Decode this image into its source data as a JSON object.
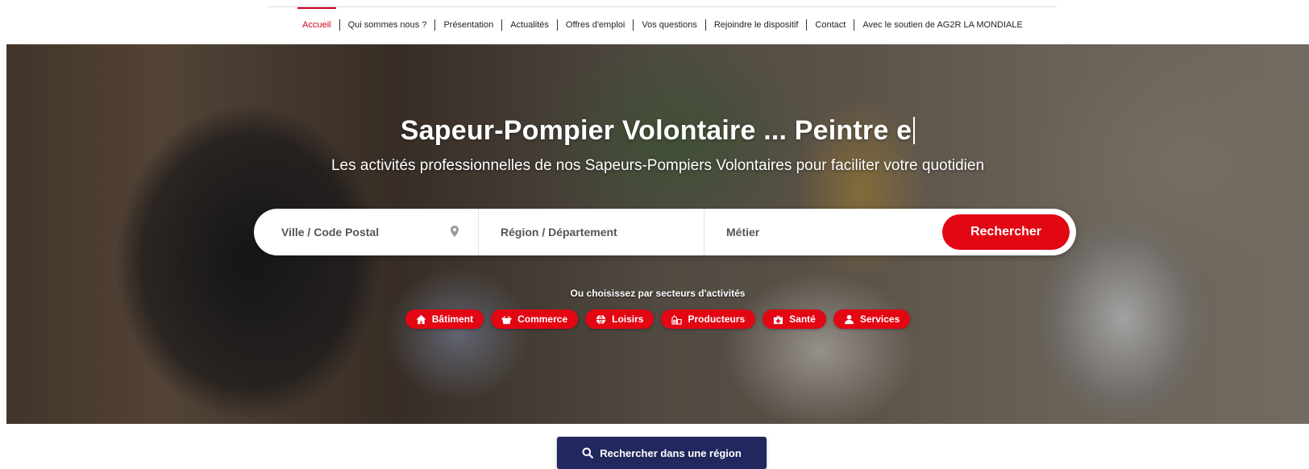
{
  "nav": {
    "items": [
      {
        "label": "Accueil",
        "active": true
      },
      {
        "label": "Qui sommes nous ?"
      },
      {
        "label": "Présentation"
      },
      {
        "label": "Actualités"
      },
      {
        "label": "Offres d'emploi"
      },
      {
        "label": "Vos questions"
      },
      {
        "label": "Rejoindre le dispositif"
      },
      {
        "label": "Contact"
      },
      {
        "label": "Avec le soutien de AG2R LA MONDIALE"
      }
    ]
  },
  "hero": {
    "title": "Sapeur-Pompier Volontaire ... Peintre e",
    "subtitle": "Les activités professionnelles de nos Sapeurs-Pompiers Volontaires pour faciliter votre quotidien",
    "background": "photo of a café terrace with a smiling waiter carrying a tray and a firefighter helmet"
  },
  "search": {
    "city_placeholder": "Ville / Code Postal",
    "city_icon": "map-pin-icon",
    "region_placeholder": "Région / Département",
    "job_placeholder": "Métier",
    "button_label": "Rechercher"
  },
  "sectors": {
    "label": "Ou choisissez par secteurs d'activités",
    "items": [
      {
        "label": "Bâtiment",
        "icon": "home-icon"
      },
      {
        "label": "Commerce",
        "icon": "basket-icon"
      },
      {
        "label": "Loisirs",
        "icon": "globe-icon"
      },
      {
        "label": "Producteurs",
        "icon": "farm-icon"
      },
      {
        "label": "Santé",
        "icon": "medical-bag-icon"
      },
      {
        "label": "Services",
        "icon": "user-icon"
      }
    ]
  },
  "region_search": {
    "label": "Rechercher dans une région",
    "icon": "search-icon"
  },
  "colors": {
    "accent_red": "#e30613",
    "nav_active": "#d0021b",
    "navy": "#20285e"
  }
}
